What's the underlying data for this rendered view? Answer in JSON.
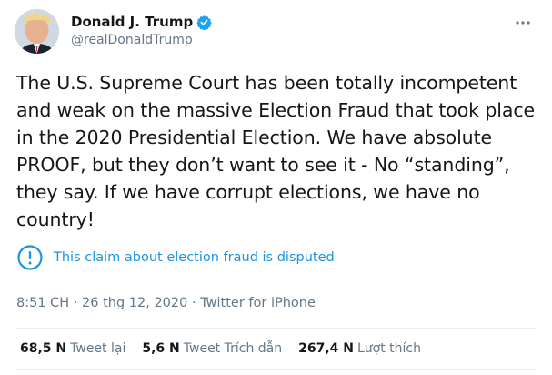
{
  "author": {
    "display_name": "Donald J. Trump",
    "handle": "@realDonaldTrump",
    "verified": true
  },
  "tweet": {
    "text": "The U.S. Supreme Court has been totally incompetent\nand weak on the massive Election Fraud that took place\nin the 2020 Presidential Election. We have absolute\nPROOF, but they don’t want to see it - No “standing”,\nthey say. If we have corrupt elections, we have no\ncountry!"
  },
  "notice": {
    "text": "This claim about election fraud is disputed"
  },
  "meta": {
    "time": "8:51 CH",
    "date": "26 thg 12, 2020",
    "source": "Twitter for iPhone",
    "separator": "·"
  },
  "stats": {
    "retweets": {
      "value": "68,5 N",
      "label": "Tweet lại"
    },
    "quotes": {
      "value": "5,6 N",
      "label": "Tweet Trích dẫn"
    },
    "likes": {
      "value": "267,4 N",
      "label": "Lượt thích"
    }
  },
  "icons": {
    "verified": "verified-badge-icon",
    "more": "more-horizontal-icon",
    "notice": "exclamation-circle-icon"
  },
  "colors": {
    "accent": "#1b95e0",
    "verified": "#1da1f2",
    "secondary_text": "#657786",
    "divider": "#e6ecf0"
  }
}
